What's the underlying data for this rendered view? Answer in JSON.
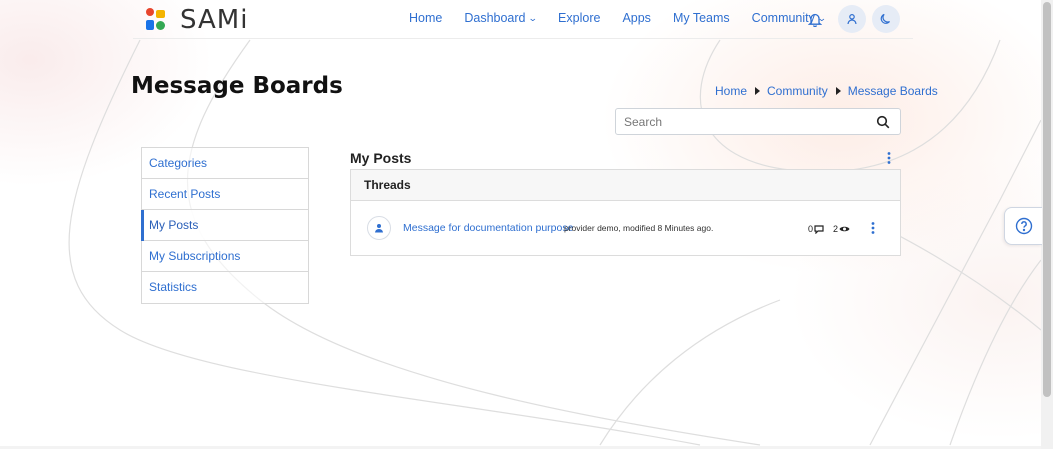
{
  "brand": {
    "name": "SAMi"
  },
  "nav": {
    "items": [
      {
        "label": "Home",
        "has_dropdown": false
      },
      {
        "label": "Dashboard",
        "has_dropdown": true
      },
      {
        "label": "Explore",
        "has_dropdown": false
      },
      {
        "label": "Apps",
        "has_dropdown": false
      },
      {
        "label": "My Teams",
        "has_dropdown": false
      },
      {
        "label": "Community",
        "has_dropdown": true
      }
    ],
    "icons": [
      "bell-icon",
      "user-icon",
      "moon-icon"
    ]
  },
  "page": {
    "title": "Message Boards"
  },
  "breadcrumb": [
    "Home",
    "Community",
    "Message Boards"
  ],
  "search": {
    "placeholder": "Search",
    "value": ""
  },
  "sidebar": {
    "items": [
      {
        "label": "Categories",
        "active": false
      },
      {
        "label": "Recent Posts",
        "active": false
      },
      {
        "label": "My Posts",
        "active": true
      },
      {
        "label": "My Subscriptions",
        "active": false
      },
      {
        "label": "Statistics",
        "active": false
      }
    ]
  },
  "main": {
    "section_title": "My Posts",
    "threads_header": "Threads",
    "threads": [
      {
        "title": "Message for documentation purpose",
        "meta": "provider demo, modified 8 Minutes ago.",
        "replies": "0",
        "views": "2"
      }
    ]
  },
  "help": {
    "icon": "help-icon"
  },
  "colors": {
    "accent": "#2f6fd0",
    "border": "#d8d8d8"
  }
}
